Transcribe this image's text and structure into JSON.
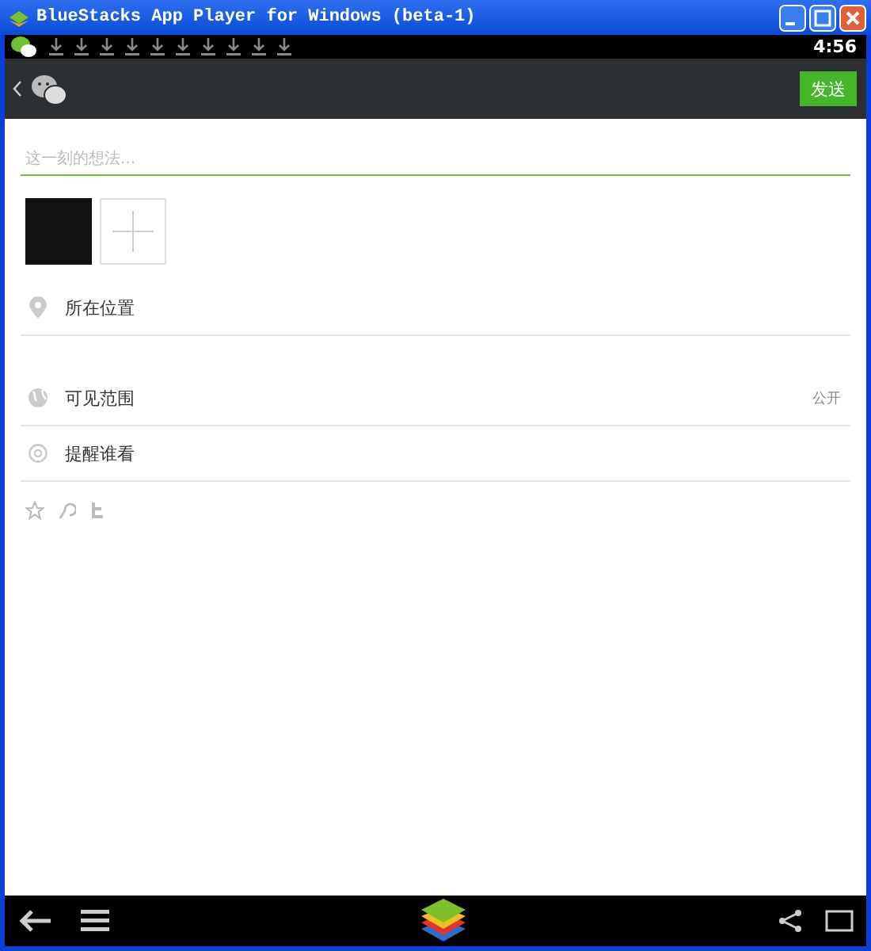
{
  "window": {
    "title": "BlueStacks App Player for Windows (beta-1)"
  },
  "status_bar": {
    "time": "4:56"
  },
  "app_bar": {
    "send_button": "发送"
  },
  "composer": {
    "placeholder": "这一刻的想法..."
  },
  "rows": [
    {
      "kind": "location",
      "label": "所在位置"
    },
    {
      "kind": "visibility",
      "label": "可见范围",
      "value": "公开"
    },
    {
      "kind": "mention",
      "label": "提醒谁看"
    }
  ]
}
